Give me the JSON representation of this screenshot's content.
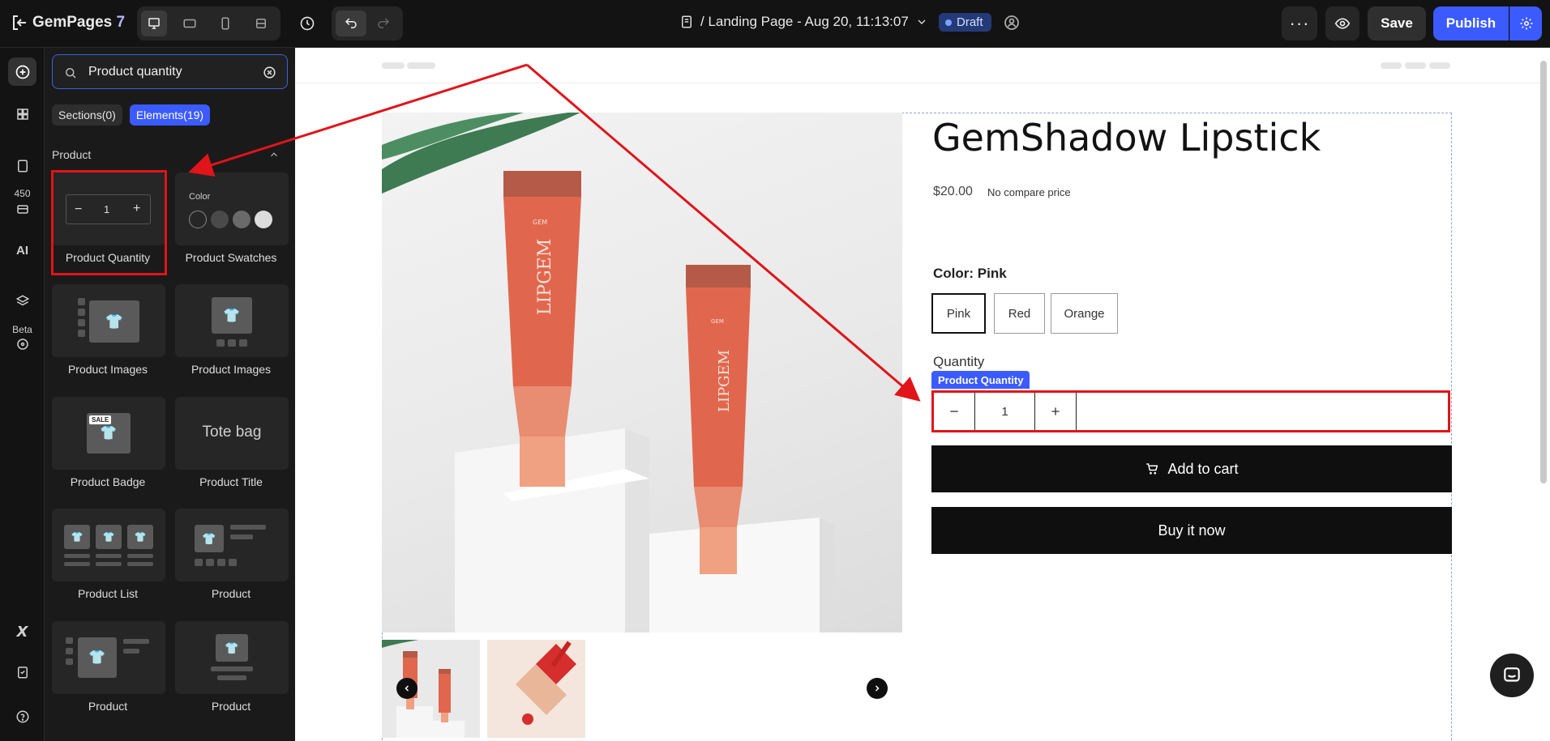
{
  "topbar": {
    "logo_text": "GemPages",
    "logo_version": "7",
    "page_title": "/ Landing Page - Aug 20, 11:13:07",
    "status": "Draft",
    "more_label": "···",
    "save_label": "Save",
    "publish_label": "Publish"
  },
  "rail": {
    "badge_count": "450",
    "ai_label": "AI",
    "beta_label": "Beta"
  },
  "panel": {
    "search_value": "Product quantity",
    "tabs": [
      {
        "label": "Sections(0)"
      },
      {
        "label": "Elements(19)"
      }
    ],
    "section_title": "Product",
    "cards": [
      {
        "label": "Product Quantity"
      },
      {
        "label": "Product Swatches"
      },
      {
        "label": "Product Images"
      },
      {
        "label": "Product Images"
      },
      {
        "label": "Product Badge"
      },
      {
        "label": "Product Title"
      },
      {
        "label": "Product List"
      },
      {
        "label": "Product"
      },
      {
        "label": "Product"
      },
      {
        "label": "Product"
      }
    ],
    "qty_preview_value": "1",
    "swatch_preview_label": "Color",
    "badge_preview_text": "SALE",
    "title_preview_text": "Tote bag"
  },
  "product": {
    "title": "GemShadow Lipstick",
    "price": "$20.00",
    "compare_price": "No compare price",
    "color_label": "Color: Pink",
    "swatches": [
      "Pink",
      "Red",
      "Orange"
    ],
    "selected_swatch": "Pink",
    "quantity_label": "Quantity",
    "quantity_tag": "Product Quantity",
    "quantity_value": "1",
    "add_to_cart_label": "Add to cart",
    "buy_now_label": "Buy it now",
    "tube_brand": "LIPGEM",
    "tube_logo": "GEM cosmetics"
  },
  "colors": {
    "accent": "#3b5bff",
    "highlight": "#e0141a",
    "tube": "#e0674e"
  }
}
